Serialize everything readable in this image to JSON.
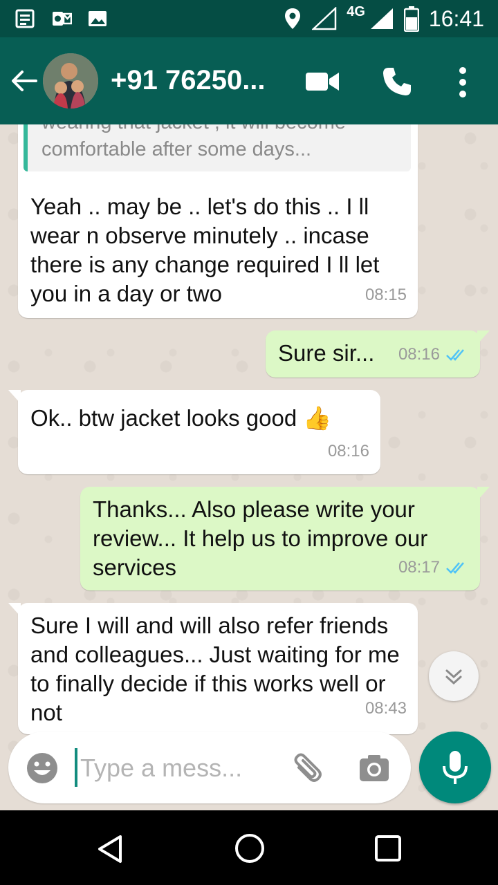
{
  "status_bar": {
    "network": "4G",
    "time": "16:41"
  },
  "header": {
    "contact_name": "+91 76250..."
  },
  "messages": [
    {
      "dir": "in",
      "quote": "wearing that jacket , it will become comfortable after some days...",
      "text": "Yeah .. may be .. let's do this .. I ll wear n observe minutely .. incase there is any change required I ll let you in a day or two",
      "time": "08:15"
    },
    {
      "dir": "out",
      "text": "Sure sir...",
      "time": "08:16",
      "status": "read"
    },
    {
      "dir": "in",
      "text": "Ok.. btw jacket looks good 👍",
      "time": "08:16"
    },
    {
      "dir": "out",
      "text": "Thanks... Also please write your review... It help us to improve our services",
      "time": "08:17",
      "status": "read"
    },
    {
      "dir": "in",
      "text": "Sure I will and will also refer friends and colleagues... Just waiting for me to finally decide if this works well or not",
      "time": "08:43"
    }
  ],
  "composer": {
    "placeholder": "Type a mess..."
  },
  "icons": {
    "status_left": [
      "notes-icon",
      "outlook-icon",
      "image-icon"
    ],
    "status_right": [
      "location-icon",
      "signal-icon",
      "battery-icon"
    ],
    "header": [
      "back-arrow-icon",
      "video-call-icon",
      "phone-icon",
      "more-vert-icon"
    ],
    "composer": [
      "emoji-icon",
      "paperclip-icon",
      "camera-icon",
      "mic-icon"
    ],
    "nav": [
      "nav-back-icon",
      "nav-home-icon",
      "nav-recents-icon"
    ]
  },
  "colors": {
    "header": "#075e54",
    "status_bar": "#054d44",
    "outgoing_bubble": "#dcf8c6",
    "incoming_bubble": "#ffffff",
    "read_ticks": "#4fc3f7",
    "mic_button": "#00897b"
  }
}
